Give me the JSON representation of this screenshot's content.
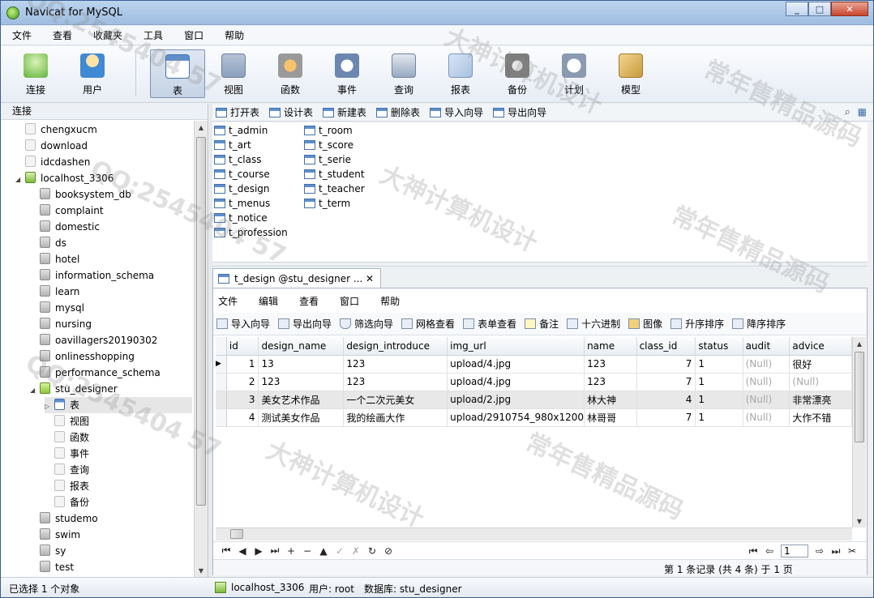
{
  "window": {
    "title": "Navicat for MySQL",
    "min": "_",
    "max": "□",
    "close": "✕"
  },
  "menu": [
    "文件",
    "查看",
    "收藏夹",
    "工具",
    "窗口",
    "帮助"
  ],
  "toolbar": [
    "连接",
    "用户",
    "表",
    "视图",
    "函数",
    "事件",
    "查询",
    "报表",
    "备份",
    "计划",
    "模型"
  ],
  "left": {
    "header": "连接",
    "tree": [
      {
        "label": "chengxucm",
        "level": 1,
        "icon": "plain"
      },
      {
        "label": "download",
        "level": 1,
        "icon": "plain"
      },
      {
        "label": "idcdashen",
        "level": 1,
        "icon": "plain"
      },
      {
        "label": "localhost_3306",
        "level": 1,
        "icon": "server",
        "expanded": true
      },
      {
        "label": "booksystem_db",
        "level": 2,
        "icon": "db"
      },
      {
        "label": "complaint",
        "level": 2,
        "icon": "db"
      },
      {
        "label": "domestic",
        "level": 2,
        "icon": "db"
      },
      {
        "label": "ds",
        "level": 2,
        "icon": "db"
      },
      {
        "label": "hotel",
        "level": 2,
        "icon": "db"
      },
      {
        "label": "information_schema",
        "level": 2,
        "icon": "db"
      },
      {
        "label": "learn",
        "level": 2,
        "icon": "db"
      },
      {
        "label": "mysql",
        "level": 2,
        "icon": "db"
      },
      {
        "label": "nursing",
        "level": 2,
        "icon": "db"
      },
      {
        "label": "oavillagers20190302",
        "level": 2,
        "icon": "db"
      },
      {
        "label": "onlinesshopping",
        "level": 2,
        "icon": "db"
      },
      {
        "label": "performance_schema",
        "level": 2,
        "icon": "db"
      },
      {
        "label": "stu_designer",
        "level": 2,
        "icon": "db-open",
        "expanded": true
      },
      {
        "label": "表",
        "level": 3,
        "icon": "table",
        "selected": true,
        "collapsed": true
      },
      {
        "label": "视图",
        "level": 3,
        "icon": "view"
      },
      {
        "label": "函数",
        "level": 3,
        "icon": "func"
      },
      {
        "label": "事件",
        "level": 3,
        "icon": "event"
      },
      {
        "label": "查询",
        "level": 3,
        "icon": "query"
      },
      {
        "label": "报表",
        "level": 3,
        "icon": "report"
      },
      {
        "label": "备份",
        "level": 3,
        "icon": "backup"
      },
      {
        "label": "studemo",
        "level": 2,
        "icon": "db"
      },
      {
        "label": "swim",
        "level": 2,
        "icon": "db"
      },
      {
        "label": "sy",
        "level": 2,
        "icon": "db"
      },
      {
        "label": "test",
        "level": 2,
        "icon": "db"
      }
    ]
  },
  "objbar": [
    "打开表",
    "设计表",
    "新建表",
    "删除表",
    "导入向导",
    "导出向导"
  ],
  "tables_col1": [
    "t_admin",
    "t_art",
    "t_class",
    "t_course",
    "t_design",
    "t_menus",
    "t_notice",
    "t_profession"
  ],
  "tables_col2": [
    "t_room",
    "t_score",
    "t_serie",
    "t_student",
    "t_teacher",
    "t_term"
  ],
  "tab": {
    "label": "t_design @stu_designer ...",
    "close": "✕"
  },
  "inner_menu": [
    "文件",
    "编辑",
    "查看",
    "窗口",
    "帮助"
  ],
  "inner_toolbar": [
    "导入向导",
    "导出向导",
    "筛选向导",
    "网格查看",
    "表单查看",
    "备注",
    "十六进制",
    "图像",
    "升序排序",
    "降序排序"
  ],
  "grid": {
    "columns": [
      "id",
      "design_name",
      "design_introduce",
      "img_url",
      "name",
      "class_id",
      "status",
      "audit",
      "advice"
    ],
    "rows": [
      [
        "1",
        "13",
        "123",
        "upload/4.jpg",
        "123",
        "7",
        "1",
        "(Null)",
        "很好"
      ],
      [
        "2",
        "123",
        "123",
        "upload/4.jpg",
        "123",
        "7",
        "1",
        "(Null)",
        "(Null)"
      ],
      [
        "3",
        "美女艺术作品",
        "一个二次元美女",
        "upload/2.jpg",
        "林大神",
        "4",
        "1",
        "(Null)",
        "非常漂亮"
      ],
      [
        "4",
        "测试美女作品",
        "我的绘画大作",
        "upload/2910754_980x1200",
        "林哥哥",
        "7",
        "1",
        "(Null)",
        "大作不错"
      ]
    ]
  },
  "nav": {
    "page": "1",
    "record_info": "第 1 条记录 (共 4 条) 于 1 页"
  },
  "status": {
    "selection": "已选择 1 个对象",
    "connection": "localhost_3306",
    "user": "用户: root",
    "database": "数据库: stu_designer"
  },
  "watermarks": [
    "QQ:2545404 57",
    "大神计算机设计",
    "常年售精品源码",
    "QQ:2545404 57",
    "大神计算机设计",
    "常年售精品源码",
    "QQ:2545404 57",
    "大神计算机设计",
    "常年售精品源码"
  ]
}
